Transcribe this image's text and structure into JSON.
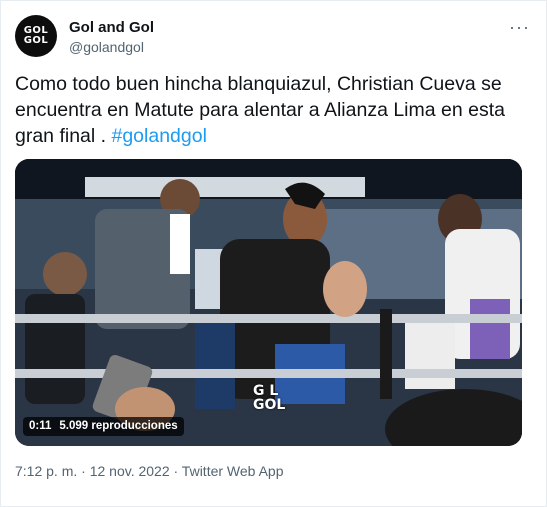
{
  "account": {
    "display_name": "Gol and Gol",
    "handle": "@golandgol",
    "avatar_line1": "GOL",
    "avatar_line2": "GOL",
    "more_icon": "···"
  },
  "tweet": {
    "text": "Como todo buen hincha blanquiazul, Christian Cueva se encuentra en Matute para alentar a Alianza Lima en esta gran final  . ",
    "hashtag": "#golandgol"
  },
  "video": {
    "duration": "0:11",
    "views": "5.099 reproducciones",
    "watermark_line1": "G  L",
    "watermark_line2": "GOL"
  },
  "meta": {
    "timestamp": "7:12 p. m. · 12 nov. 2022 · Twitter Web App"
  },
  "colors": {
    "text": "#0f1419",
    "secondary": "#536471",
    "link": "#1d9bf0"
  }
}
